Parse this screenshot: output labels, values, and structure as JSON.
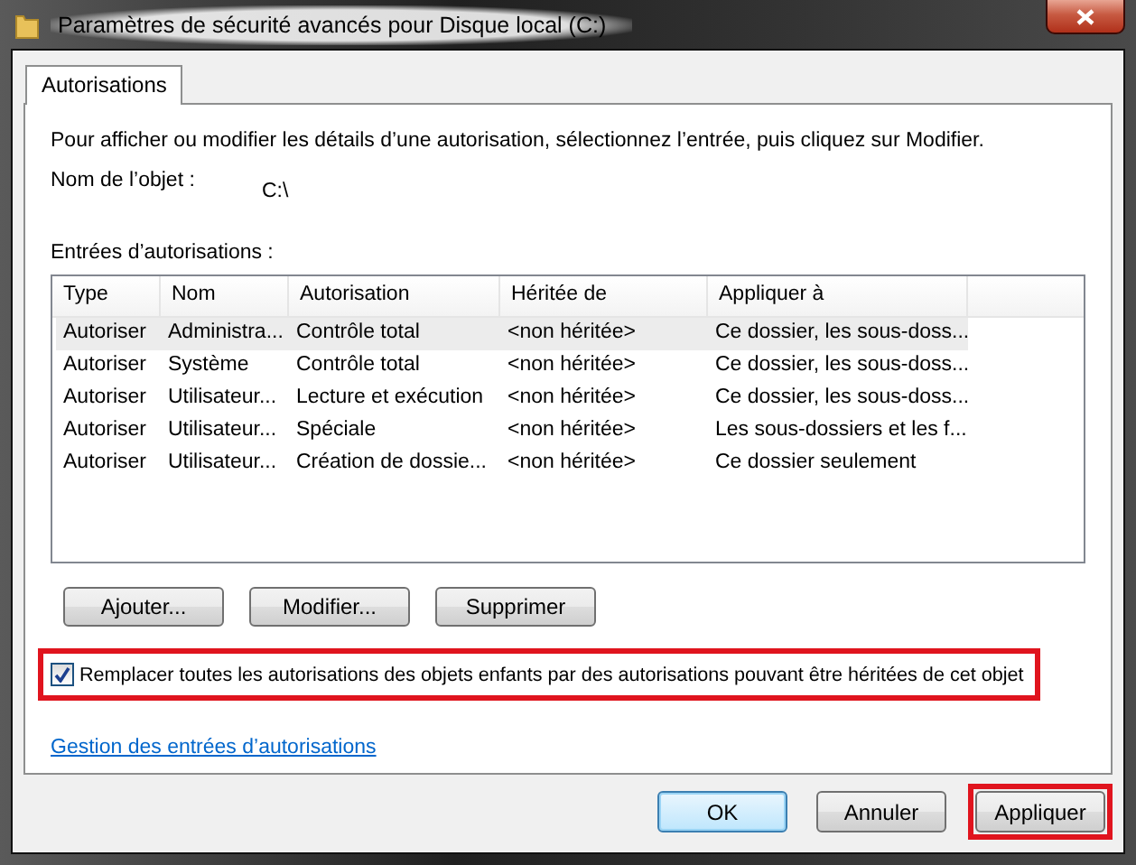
{
  "window": {
    "title": "Paramètres de sécurité avancés pour Disque local (C:)"
  },
  "tabs": [
    {
      "label": "Autorisations",
      "selected": true
    }
  ],
  "instructions": "Pour afficher ou modifier les détails d’une autorisation, sélectionnez l’entrée, puis cliquez sur Modifier.",
  "object_name": {
    "label": "Nom de l’objet :",
    "value": "C:\\"
  },
  "entries_label": "Entrées d’autorisations :",
  "table": {
    "columns": [
      "Type",
      "Nom",
      "Autorisation",
      "Héritée de",
      "Appliquer à"
    ],
    "rows": [
      {
        "cells": [
          "Autoriser",
          "Administra...",
          "Contrôle total",
          "<non héritée>",
          "Ce dossier, les sous-doss..."
        ],
        "selected": true
      },
      {
        "cells": [
          "Autoriser",
          "Système",
          "Contrôle total",
          "<non héritée>",
          "Ce dossier, les sous-doss..."
        ],
        "selected": false
      },
      {
        "cells": [
          "Autoriser",
          "Utilisateur...",
          "Lecture et exécution",
          "<non héritée>",
          "Ce dossier, les sous-doss..."
        ],
        "selected": false
      },
      {
        "cells": [
          "Autoriser",
          "Utilisateur...",
          "Spéciale",
          "<non héritée>",
          "Les sous-dossiers et les f..."
        ],
        "selected": false
      },
      {
        "cells": [
          "Autoriser",
          "Utilisateur...",
          "Création de dossie...",
          "<non héritée>",
          "Ce dossier seulement"
        ],
        "selected": false
      }
    ]
  },
  "entry_buttons": [
    "Ajouter...",
    "Modifier...",
    "Supprimer"
  ],
  "replace_checkbox": {
    "label": "Remplacer toutes les autorisations des objets enfants par des autorisations pouvant être héritées de cet objet",
    "checked": true,
    "highlighted": true
  },
  "link": "Gestion des entrées d’autorisations",
  "dialog_buttons": [
    {
      "label": "OK",
      "default": true,
      "highlighted": false
    },
    {
      "label": "Annuler",
      "default": false,
      "highlighted": false
    },
    {
      "label": "Appliquer",
      "default": false,
      "highlighted": true
    }
  ]
}
